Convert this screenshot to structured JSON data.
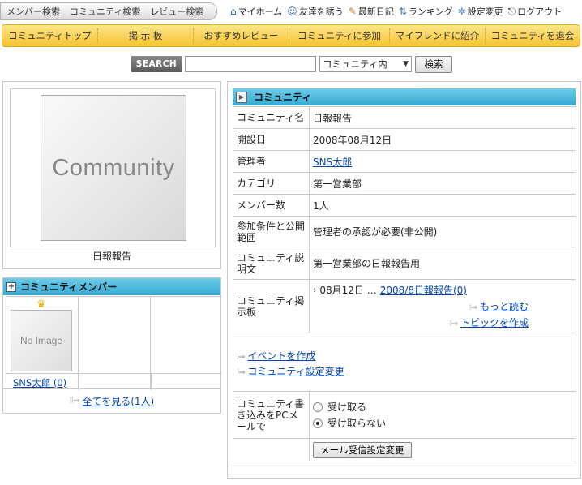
{
  "top_left_nav": [
    "メンバー検索",
    "コミュニティ検索",
    "レビュー検索"
  ],
  "top_right_nav": [
    {
      "label": "マイホーム",
      "icon": "home-icon"
    },
    {
      "label": "友達を誘う",
      "icon": "invite-icon"
    },
    {
      "label": "最新日記",
      "icon": "pencil-icon"
    },
    {
      "label": "ランキング",
      "icon": "ranking-icon"
    },
    {
      "label": "設定変更",
      "icon": "gear-icon"
    },
    {
      "label": "ログアウト",
      "icon": "logout-icon"
    }
  ],
  "menu": [
    "コミュニティトップ",
    "掲 示 板",
    "おすすめレビュー",
    "コミュニティに参加",
    "マイフレンドに紹介",
    "コミュニティを退会"
  ],
  "search": {
    "label": "SEARCH",
    "value": "",
    "scope": "コミュニティ内",
    "button": "検索"
  },
  "left": {
    "photo_text": "Community",
    "community_name": "日報報告"
  },
  "members": {
    "title": "コミュニティメンバー",
    "no_image_text": "No Image",
    "member_name": "SNS太郎 (0)",
    "see_all": "全てを見る(1人)"
  },
  "community": {
    "title": "コミュニティ",
    "rows": {
      "name_label": "コミュニティ名",
      "name_value": "日報報告",
      "opened_label": "開設日",
      "opened_value": "2008年08月12日",
      "admin_label": "管理者",
      "admin_value": "SNS太郎",
      "category_label": "カテゴリ",
      "category_value": "第一営業部",
      "count_label": "メンバー数",
      "count_value": "1人",
      "join_label": "参加条件と公開範囲",
      "join_value": "管理者の承認が必要(非公開)",
      "desc_label": "コミュニティ説明文",
      "desc_value": "第一営業部の日報報告用",
      "board_label": "コミュニティ掲示板",
      "board_date": "08月12日 …",
      "board_topic": "2008/8日報報告(0)",
      "read_more": "もっと読む",
      "create_topic": "トピックを作成",
      "create_event": "イベントを作成",
      "change_settings": "コミュニティ設定変更",
      "mail_label": "コミュニティ書き込みをPCメールで",
      "mail_receive": "受け取る",
      "mail_not_receive": "受け取らない",
      "mail_button": "メール受信設定変更"
    }
  },
  "colors": {
    "menu_gold": "#f5c330",
    "header_blue": "#36aad3",
    "link": "#0645ad"
  }
}
